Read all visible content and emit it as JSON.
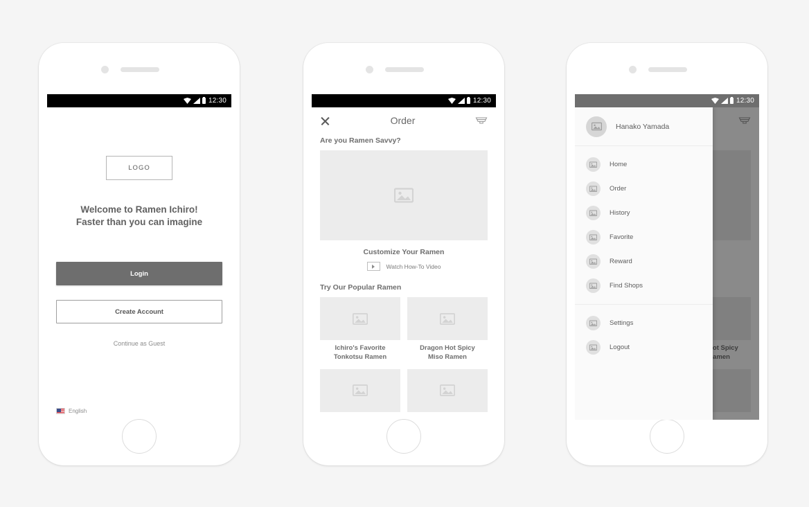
{
  "status_bar": {
    "time": "12:30",
    "icons": [
      "wifi-icon",
      "signal-icon",
      "battery-icon"
    ]
  },
  "screen_welcome": {
    "logo_label": "LOGO",
    "headline_line1": "Welcome to Ramen Ichiro!",
    "headline_line2": "Faster than you can imagine",
    "login_label": "Login",
    "create_account_label": "Create Account",
    "guest_label": "Continue as Guest",
    "language_label": "English",
    "colors": {
      "primary_button": "#6e6e6e",
      "text": "#616161",
      "border": "#9e9e9e"
    }
  },
  "screen_order": {
    "appbar": {
      "title": "Order",
      "close_icon": "close-icon",
      "menu_icon": "ramen-bowl-icon"
    },
    "section_savvy": {
      "title": "Are you Ramen Savvy?",
      "hero_caption": "Customize Your Ramen",
      "video_label": "Watch How-To Video",
      "play_icon": "play-icon"
    },
    "section_popular": {
      "title": "Try Our Popular Ramen",
      "items": [
        {
          "title_line1": "Ichiro's Favorite",
          "title_line2": "Tonkotsu Ramen"
        },
        {
          "title_line1": "Dragon Hot Spicy",
          "title_line2": "Miso Ramen"
        },
        {
          "title_line1": "",
          "title_line2": ""
        },
        {
          "title_line1": "",
          "title_line2": ""
        }
      ]
    }
  },
  "screen_drawer": {
    "user_name": "Hanako Yamada",
    "avatar_icon": "avatar-image-icon",
    "primary_items": [
      {
        "label": "Home",
        "icon": "image-placeholder-icon"
      },
      {
        "label": "Order",
        "icon": "image-placeholder-icon"
      },
      {
        "label": "History",
        "icon": "image-placeholder-icon"
      },
      {
        "label": "Favorite",
        "icon": "image-placeholder-icon"
      },
      {
        "label": "Reward",
        "icon": "image-placeholder-icon"
      },
      {
        "label": "Find Shops",
        "icon": "image-placeholder-icon"
      }
    ],
    "secondary_items": [
      {
        "label": "Settings",
        "icon": "image-placeholder-icon"
      },
      {
        "label": "Logout",
        "icon": "image-placeholder-icon"
      }
    ],
    "scrim_color": "#000000"
  }
}
